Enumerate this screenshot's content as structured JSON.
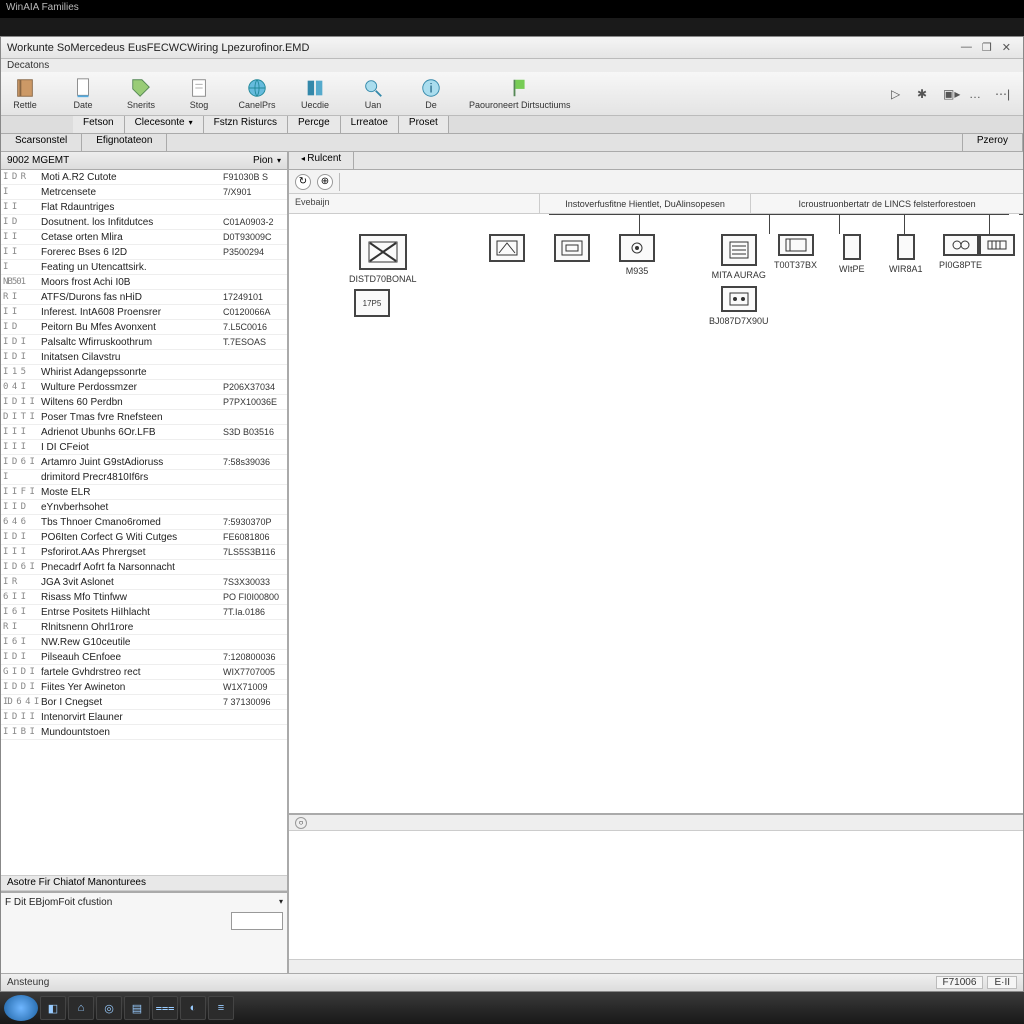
{
  "top_title": "WinAIA Families",
  "window": {
    "title": "Workunte SoMercedeus EusFECWCWiring Lpezurofinor.EMD",
    "subtitle": "Decatons"
  },
  "win_controls": {
    "min": "—",
    "max": "❐",
    "close": "✕"
  },
  "toolbar": [
    {
      "label": "Rettle"
    },
    {
      "label": "Date"
    },
    {
      "label": "Snerits"
    },
    {
      "label": "Stog"
    },
    {
      "label": "CanelPrs"
    },
    {
      "label": "Uecdie"
    },
    {
      "label": "Uan"
    },
    {
      "label": "De"
    },
    {
      "label": "Paouroneert Dirtsuctiums"
    }
  ],
  "toolbar_right": [
    "▷",
    "✱",
    "▣▸",
    "…",
    "⋯|"
  ],
  "tabs": [
    "Fetson",
    "Clecesonte",
    "Fstzn Risturcs",
    "Percge",
    "Lrreatoe",
    "Proset"
  ],
  "subtabs": {
    "left": "Scarsonstel",
    "mid": "Efignotateon",
    "right": "Pzeroy"
  },
  "left_panel": {
    "header_left": "9002 MGEMT",
    "header_right": "Pion",
    "detail_title": "F Dit EBjomFoit cfustion",
    "section_footer": "Asotre Fir Chiatof Manonturees"
  },
  "tree": [
    {
      "exp": "I  D  R",
      "name": "Moti A.R2 Cutote",
      "code": "F91030B S"
    },
    {
      "exp": "     I",
      "name": "Metrcensete",
      "code": "7/X901"
    },
    {
      "exp": "I  I",
      "name": "Flat Rdauntriges",
      "code": ""
    },
    {
      "exp": "I  D",
      "name": "Dosutnent. los Infitdutces",
      "code": "C01A0903-2"
    },
    {
      "exp": "I  I",
      "name": "Cetase orten Mlira",
      "code": "D0T93009C"
    },
    {
      "exp": "I  I",
      "name": "Forerec Bses 6 I2D",
      "code": "P3500294"
    },
    {
      "exp": "   I",
      "name": "Feating un Utencattsirk.",
      "code": ""
    },
    {
      "exp": "NB501",
      "name": "Moors frost Achi I0B",
      "code": ""
    },
    {
      "exp": "R  I",
      "name": "ATFS/Durons fas nHiD",
      "code": "17249101"
    },
    {
      "exp": "I  I",
      "name": "Inferest. IntA608 Proensrer",
      "code": "C0120066A"
    },
    {
      "exp": "I  D",
      "name": "Peitorn Bu Mfes Avonxent",
      "code": "7.L5C0016"
    },
    {
      "exp": "I  D  I",
      "name": "Palsaltc Wfirruskoothrum",
      "code": "T.7ESOAS"
    },
    {
      "exp": "I  D I",
      "name": "Initatsen Cilavstru",
      "code": ""
    },
    {
      "exp": "I 1 5",
      "name": "Whirist Adangepssonrte",
      "code": ""
    },
    {
      "exp": "0 4 I",
      "name": "Wulture Perdossmzer",
      "code": "P206X37034"
    },
    {
      "exp": "I D I I",
      "name": "Wiltens 60 Perdbn",
      "code": "P7PX10036E"
    },
    {
      "exp": "D I T I",
      "name": "Poser Tmas fvre Rnefsteen",
      "code": ""
    },
    {
      "exp": "I I I",
      "name": "Adrienot Ubunhs 6Or.LFB",
      "code": "S3D B03516"
    },
    {
      "exp": "I I I",
      "name": "I DI CFeiot",
      "code": ""
    },
    {
      "exp": "I D 6 I",
      "name": "Artamro Juint G9stAdioruss",
      "code": "7:58s39036"
    },
    {
      "exp": "     I",
      "name": "drimitord Precr4810If6rs",
      "code": ""
    },
    {
      "exp": "I I F I",
      "name": "Moste ELR",
      "code": ""
    },
    {
      "exp": "I  I  D",
      "name": "eYnvberhsohet",
      "code": ""
    },
    {
      "exp": "6  4  6",
      "name": "Tbs Thnoer Cmano6romed",
      "code": "7:5930370P"
    },
    {
      "exp": "I D I",
      "name": "PO6Iten Corfect G Witi Cutges",
      "code": "FE6081806"
    },
    {
      "exp": "I  I  I",
      "name": "Psforirot.AAs Phrergset",
      "code": "7LS5S3B116"
    },
    {
      "exp": "I D 6 I",
      "name": "Pnecadrf Aofrt fa Narsonnacht",
      "code": ""
    },
    {
      "exp": "I  R",
      "name": "JGA 3vit Aslonet",
      "code": "7S3X30033"
    },
    {
      "exp": "6 I I",
      "name": "Risass Mfo Ttinfww",
      "code": "PO FI0I00800"
    },
    {
      "exp": "I 6 I",
      "name": "Entrse Positets HiIhlacht",
      "code": "7T.Ia.0186"
    },
    {
      "exp": "R I",
      "name": "Rlnitsnenn Ohrl1rore",
      "code": ""
    },
    {
      "exp": "I 6 I",
      "name": "NW.Rew G10ceutile",
      "code": ""
    },
    {
      "exp": "I  D  I",
      "name": "Pilseauh CEnfoee",
      "code": "7:120800036"
    },
    {
      "exp": "G I D I",
      "name": "fartele Gvhdrstreo rect",
      "code": "WIX7707005"
    },
    {
      "exp": "I D D I",
      "name": "Fiites Yer Awineton",
      "code": "W1X71009"
    },
    {
      "exp": "ID 6 4  I",
      "name": "Bor I Cnegset",
      "code": "7 37130096"
    },
    {
      "exp": "I D I I",
      "name": "Intenorvirt Elauner",
      "code": ""
    },
    {
      "exp": "I I B I",
      "name": "Mundountstoen",
      "code": ""
    }
  ],
  "right": {
    "tab": "Rulcent",
    "canvas_left_label": "Evebaijn",
    "group1": "Instoverfusfitne Hientlet, DuAlinsopesen",
    "group2": "Icroustruonbertatr de LINCS felsterforestoen"
  },
  "nodes": {
    "main": {
      "label": "DISTD70BONAL"
    },
    "sub": {
      "label": "17P5"
    },
    "n1": {
      "label": ""
    },
    "n2": {
      "label": ""
    },
    "n3": {
      "label": "M935"
    },
    "n4": {
      "label": "MITA AURAG",
      "sublabel": "BJ087D7X90U"
    },
    "n5": {
      "label": "T00T37BX"
    },
    "n6": {
      "label": "WItPE"
    },
    "n7": {
      "label": "WIR8A1"
    },
    "n8": {
      "label": "PI0G8PTE"
    }
  },
  "statusbar": {
    "left": "Ansteung",
    "r1": "F71006",
    "r2": "E·II"
  },
  "taskbar_icons": [
    "◧",
    "⌂",
    "◎",
    "▤",
    "⩶",
    "◐",
    "≡"
  ]
}
